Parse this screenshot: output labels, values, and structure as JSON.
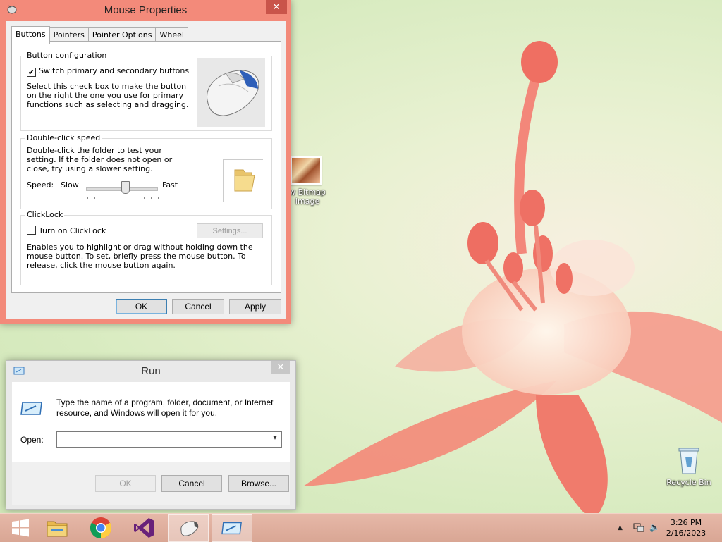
{
  "colors": {
    "mouse_frame": "#f38a7a",
    "run_frame": "#e9e9e9",
    "taskbar": "#dcaa98",
    "close_red": "#c9544a"
  },
  "desktop": {
    "icons": [
      {
        "label_line1": "w Bitmap",
        "label_line2": "Image",
        "icon": "bitmap-image-icon"
      },
      {
        "label": "Recycle Bin",
        "icon": "recycle-bin-icon"
      }
    ]
  },
  "mouse_properties": {
    "title": "Mouse Properties",
    "close_label": "✕",
    "tabs": [
      "Buttons",
      "Pointers",
      "Pointer Options",
      "Wheel"
    ],
    "active_tab": "Buttons",
    "button_configuration": {
      "title": "Button configuration",
      "checkbox_label": "Switch primary and secondary buttons",
      "checked": true,
      "description": "Select this check box to make the button on the right the one you use for primary functions such as selecting and dragging."
    },
    "double_click": {
      "title": "Double-click speed",
      "description": "Double-click the folder to test your setting. If the folder does not open or close, try using a slower setting.",
      "speed_label": "Speed:",
      "slow_label": "Slow",
      "fast_label": "Fast",
      "slider_level": 0.55
    },
    "clicklock": {
      "title": "ClickLock",
      "checkbox_label": "Turn on ClickLock",
      "checked": false,
      "settings_label": "Settings...",
      "description": "Enables you to highlight or drag without holding down the mouse button. To set, briefly press the mouse button. To release, click the mouse button again."
    },
    "buttons": {
      "ok": "OK",
      "cancel": "Cancel",
      "apply": "Apply"
    }
  },
  "run_dialog": {
    "title": "Run",
    "close_label": "✕",
    "description": "Type the name of a program, folder, document, or Internet resource, and Windows will open it for you.",
    "open_label": "Open:",
    "open_value": "",
    "buttons": {
      "ok": "OK",
      "cancel": "Cancel",
      "browse": "Browse..."
    }
  },
  "taskbar": {
    "items": [
      "start-icon",
      "file-explorer-icon",
      "chrome-icon",
      "visual-studio-icon",
      "mouse-properties-icon",
      "run-icon"
    ],
    "clock_time": "3:26 PM",
    "clock_date": "2/16/2023",
    "tray_chevron": "▲",
    "tray_speaker": "🔈"
  }
}
